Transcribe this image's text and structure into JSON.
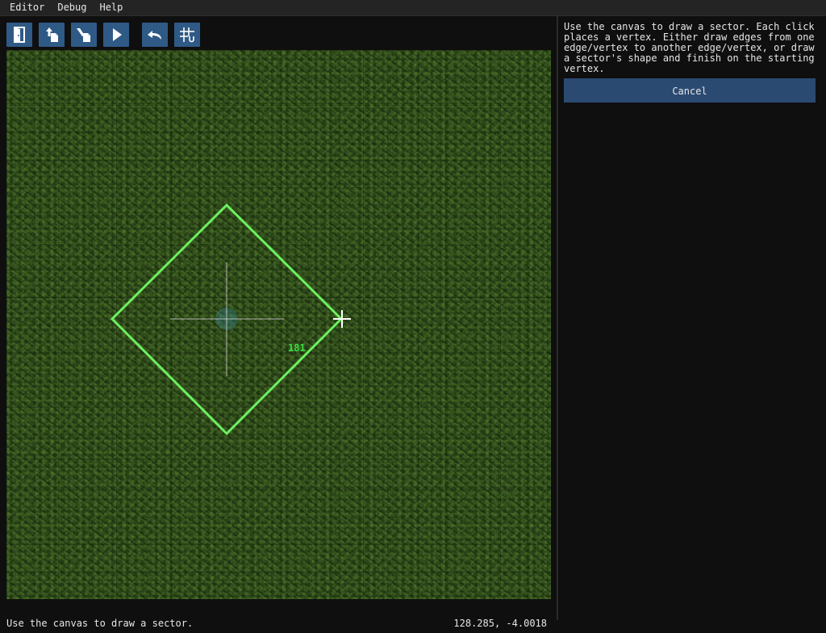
{
  "menubar": {
    "items": [
      {
        "label": "Editor"
      },
      {
        "label": "Debug"
      },
      {
        "label": "Help"
      }
    ]
  },
  "toolbar": {
    "buttons": [
      {
        "icon": "door-exit-icon",
        "action": "quit"
      },
      {
        "icon": "upload-icon",
        "action": "load"
      },
      {
        "icon": "save-icon",
        "action": "save"
      },
      {
        "icon": "play-icon",
        "action": "play"
      },
      {
        "icon": "undo-icon",
        "action": "undo"
      },
      {
        "icon": "grid-snap-icon",
        "action": "snap-to-grid"
      }
    ],
    "button_color": "#2f5a86"
  },
  "canvas": {
    "texture": "grass",
    "sector_outline_color": "#6cf060",
    "edge_length_label": "181",
    "edge_label_color": "#38e040",
    "crosshair_color": "#ffffff"
  },
  "status": {
    "message": "Use the canvas to draw a sector.",
    "coordinates": "128.285, -4.0018"
  },
  "side_panel": {
    "instructions": "Use the canvas to draw a sector. Each click places a vertex. Either draw edges from one edge/vertex to another edge/vertex, or draw a sector's shape and finish on the starting vertex.",
    "cancel_label": "Cancel",
    "cancel_color": "#2b4a72"
  }
}
